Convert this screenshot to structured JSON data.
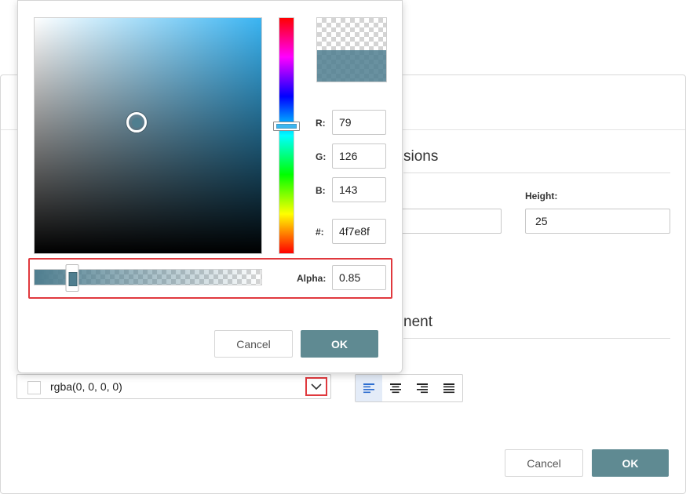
{
  "dialog": {
    "sections": {
      "dimensions_title": "sions",
      "alignment_title": "nent"
    },
    "height_label": "Height:",
    "height_value": "25",
    "width_value": "",
    "color_field": {
      "value": "rgba(0, 0, 0, 0)"
    },
    "cancel_label": "Cancel",
    "ok_label": "OK",
    "alignment_options": [
      "align-left",
      "align-center",
      "align-right",
      "align-justify"
    ],
    "active_alignment": "align-left"
  },
  "color_picker": {
    "r_label": "R:",
    "g_label": "G:",
    "b_label": "B:",
    "hex_label": "#:",
    "r": "79",
    "g": "126",
    "b": "143",
    "hex": "4f7e8f",
    "alpha_label": "Alpha:",
    "alpha": "0.85",
    "cancel_label": "Cancel",
    "ok_label": "OK",
    "hue_color": "#3ab4f2",
    "selected_color": "#4f7e8f"
  },
  "colors": {
    "primary_button": "#5f8a92",
    "highlight_border": "#e0393e",
    "active_align_bg": "#e4ecf8"
  }
}
